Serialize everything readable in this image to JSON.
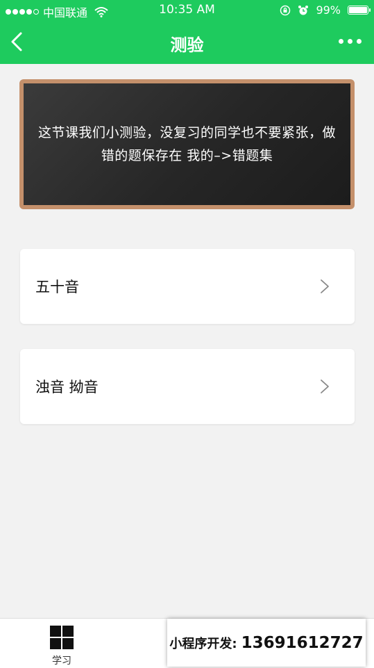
{
  "status_bar": {
    "carrier": "中国联通",
    "time": "10:35 AM",
    "battery_percent": "99%",
    "signal_bars": 4,
    "battery_level": 0.99
  },
  "nav": {
    "title": "测验",
    "back_icon": "chevron-left-icon",
    "more_icon": "more-dots-icon"
  },
  "blackboard": {
    "message": "这节课我们小测验，没复习的同学也不要紧张，做错的题保存在 我的–>错题集"
  },
  "quiz_items": [
    {
      "label": "五十音"
    },
    {
      "label": "浊音 拗音"
    }
  ],
  "tab_bar": {
    "tabs": [
      {
        "label": "学习",
        "icon": "grid-icon"
      }
    ]
  },
  "promo": {
    "label": "小程序开发:",
    "phone": "13691612727"
  },
  "colors": {
    "accent": "#1ecb5e",
    "board_frame": "#c4906b",
    "board": "#2a2a2a"
  }
}
